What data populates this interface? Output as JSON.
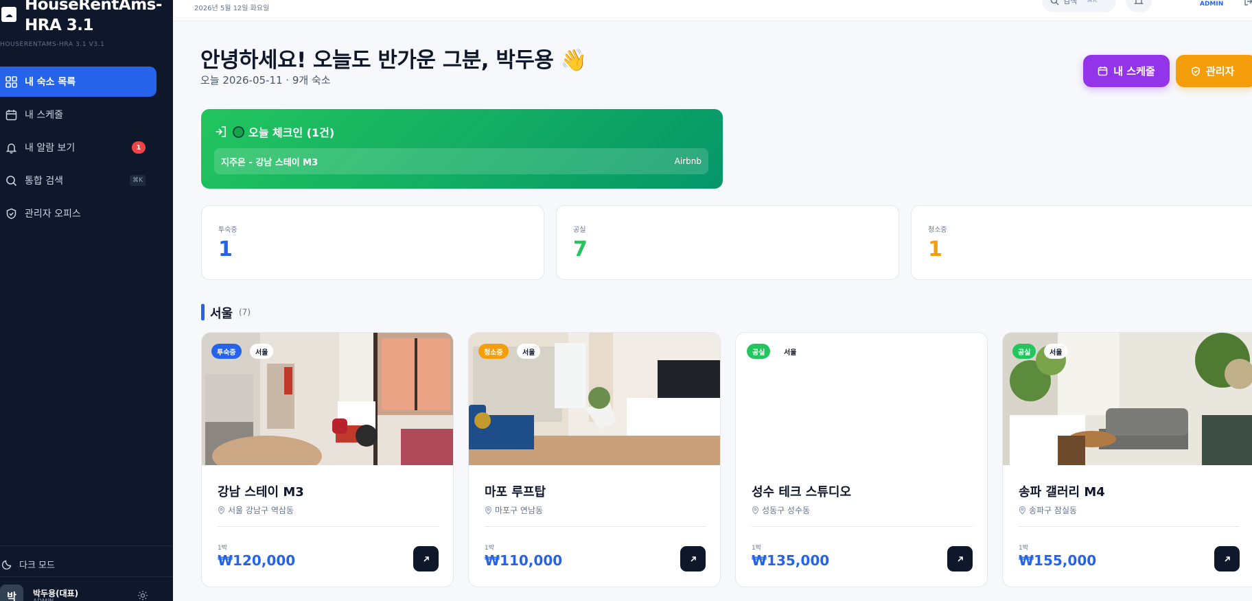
{
  "sidebar": {
    "logo_glyph": "☁",
    "brand": "HouseRentAms-HRA 3.1",
    "brand_sub": "HOUSERENTAMS-HRA 3.1 V3.1",
    "items": [
      {
        "label": "내 숙소 목록",
        "icon": "grid-icon"
      },
      {
        "label": "내 스케줄",
        "icon": "calendar-icon"
      },
      {
        "label": "내 알람 보기",
        "icon": "bell-icon",
        "badge": "1"
      },
      {
        "label": "통합 검색",
        "icon": "search-icon",
        "shortcut": "⌘K"
      },
      {
        "label": "관리자 오피스",
        "icon": "shield-icon"
      }
    ],
    "dark_mode": "다크 모드",
    "user": {
      "avatar": "박",
      "name": "박두용(대표)",
      "role": "ADMIN"
    }
  },
  "topbar": {
    "date": "2026년 5월 12일 화요일",
    "search_label": "검색",
    "search_shortcut": "⌘K",
    "admin_label": "ADMIN"
  },
  "header": {
    "greeting": "안녕하세요! 오늘도 반가운 그분, 박두용 👋",
    "sub": "오늘 2026-05-11 · 9개 숙소",
    "schedule_button": "내 스케줄",
    "admin_button": "관리자"
  },
  "checkin": {
    "title": "오늘 체크인 (1건)",
    "guest": "지주은 - 강남 스테이 M3",
    "channel": "Airbnb"
  },
  "stats": [
    {
      "label": "투숙중",
      "value": "1",
      "color": "#2563eb"
    },
    {
      "label": "공실",
      "value": "7",
      "color": "#22c55e"
    },
    {
      "label": "청소중",
      "value": "1",
      "color": "#f59e0b"
    }
  ],
  "section": {
    "title": "서울",
    "count": "(7)"
  },
  "cards": [
    {
      "status": "투숙중",
      "status_color": "#2563eb",
      "region": "서울",
      "name": "강남 스테이 M3",
      "address": "서울 강남구 역삼동",
      "night_label": "1박",
      "price": "₩120,000"
    },
    {
      "status": "청소중",
      "status_color": "#f59e0b",
      "region": "서울",
      "name": "마포 루프탑",
      "address": "마포구 연남동",
      "night_label": "1박",
      "price": "₩110,000"
    },
    {
      "status": "공실",
      "status_color": "#22c55e",
      "region": "서울",
      "name": "성수 테크 스튜디오",
      "address": "성동구 성수동",
      "night_label": "1박",
      "price": "₩135,000"
    },
    {
      "status": "공실",
      "status_color": "#22c55e",
      "region": "서울",
      "name": "송파 갤러리 M4",
      "address": "송파구 잠실동",
      "night_label": "1박",
      "price": "₩155,000"
    }
  ]
}
